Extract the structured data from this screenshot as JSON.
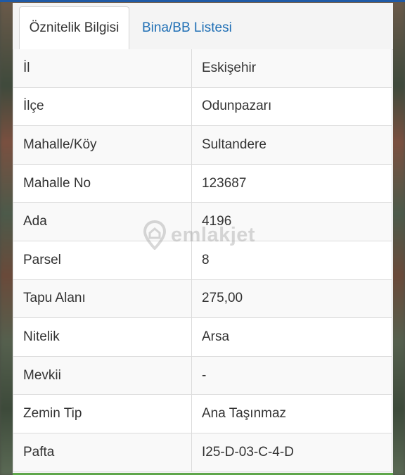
{
  "tabs": [
    {
      "label": "Öznitelik Bilgisi",
      "active": true
    },
    {
      "label": "Bina/BB Listesi",
      "active": false
    }
  ],
  "rows": [
    {
      "key": "İl",
      "value": "Eskişehir"
    },
    {
      "key": "İlçe",
      "value": "Odunpazarı"
    },
    {
      "key": "Mahalle/Köy",
      "value": "Sultandere"
    },
    {
      "key": "Mahalle No",
      "value": "123687"
    },
    {
      "key": "Ada",
      "value": "4196"
    },
    {
      "key": "Parsel",
      "value": "8"
    },
    {
      "key": "Tapu Alanı",
      "value": "275,00"
    },
    {
      "key": "Nitelik",
      "value": "Arsa"
    },
    {
      "key": "Mevkii",
      "value": "-"
    },
    {
      "key": "Zemin Tip",
      "value": "Ana Taşınmaz"
    },
    {
      "key": "Pafta",
      "value": "I25-D-03-C-4-D"
    }
  ],
  "watermark": {
    "text": "emlakjet",
    "icon": "location-pin-icon"
  },
  "colors": {
    "accent": "#1f6fb5",
    "text": "#333333",
    "border": "#dcdcdc"
  }
}
